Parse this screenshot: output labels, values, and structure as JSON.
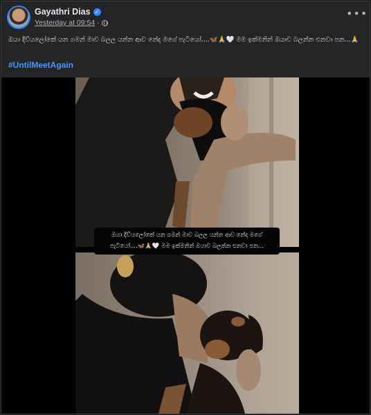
{
  "post": {
    "author": "Gayathri Dias",
    "timestamp": "Yesterday at 09:54",
    "separator": "·",
    "more_label": "•••",
    "verified_mark": "✓",
    "caption": "ඔයා දිව්යලෝකේ යන ගමන් මාව බලල යන්න ආව නේද මගේ පැටියෝ....🦋🙏🤍 මම ඉක්මනින් ඔයාව බලන්න එනවා පන...🙏",
    "hashtag": "#UntilMeetAgain",
    "image_text": "ඔයා දිව්යලෝකේ යන ගමන් මාව බලල යන්න ආව නේද මගේ පැටියෝ....🦋🙏🤍 මම ඉක්මනින් ඔයාව බලන්න එනවා පන..."
  },
  "icons": {
    "avatar": "profile-photo",
    "verified": "verified-badge-icon",
    "globe": "globe-icon",
    "more": "more-options-icon"
  },
  "colors": {
    "background": "#18191a",
    "card": "#242526",
    "text": "#e4e6eb",
    "secondary_text": "#b0b3b8",
    "link": "#4599ff",
    "verified": "#2d88ff"
  }
}
